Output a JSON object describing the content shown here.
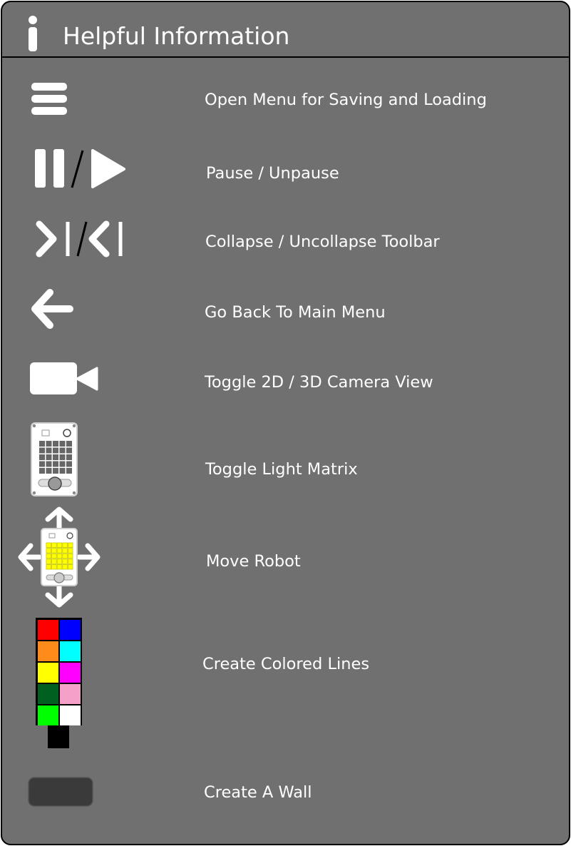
{
  "header": {
    "title": "Helpful Information",
    "icon": "info-icon"
  },
  "rows": [
    {
      "icon": "hamburger-menu-icon",
      "label": "Open Menu for Saving and Loading"
    },
    {
      "icon": "pause-play-icon",
      "label": "Pause / Unpause"
    },
    {
      "icon": "collapse-toolbar-icon",
      "label": "Collapse / Uncollapse Toolbar"
    },
    {
      "icon": "back-arrow-icon",
      "label": "Go Back To Main Menu"
    },
    {
      "icon": "video-camera-icon",
      "label": "Toggle 2D / 3D Camera View"
    },
    {
      "icon": "light-matrix-icon",
      "label": "Toggle Light Matrix"
    },
    {
      "icon": "move-robot-icon",
      "label": "Move Robot"
    },
    {
      "icon": "color-palette-icon",
      "label": "Create Colored Lines"
    },
    {
      "icon": "wall-block-icon",
      "label": "Create A Wall"
    }
  ],
  "palette_colors": [
    "#ff0000",
    "#0000ff",
    "#ff8c1a",
    "#00ffff",
    "#ffff00",
    "#ff00ff",
    "#006020",
    "#f4a0c8",
    "#00ff00",
    "#ffffff"
  ],
  "colors": {
    "panel_bg": "#707070",
    "border": "#000000",
    "icon": "#ffffff",
    "wall": "#3a3a3a",
    "matrix_lit": "#ffff00"
  }
}
